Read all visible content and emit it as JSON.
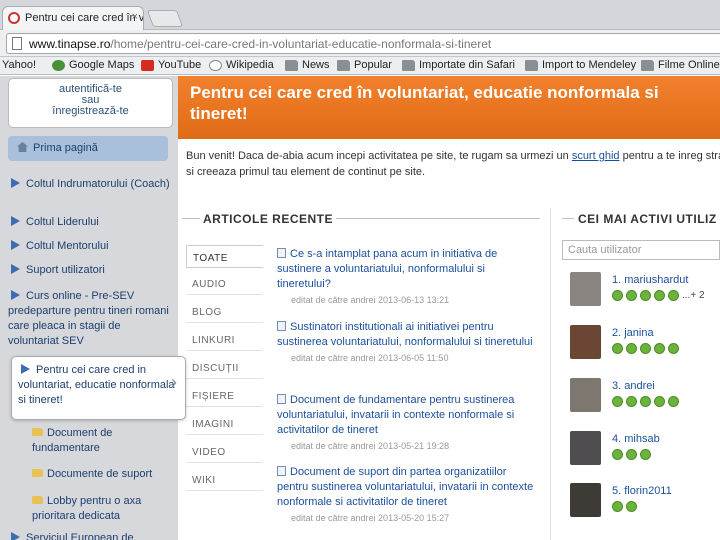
{
  "browser": {
    "tab_title": "Pentru cei care cred în volu",
    "close_glyph": "×",
    "url_host": "www.tinapse.ro",
    "url_path": "/home/pentru-cei-care-cred-in-voluntariat-educatie-nonformala-si-tineret",
    "bookmarks": [
      "Yahoo!",
      "Google Maps",
      "YouTube",
      "Wikipedia",
      "News",
      "Popular",
      "Importate din Safari",
      "Import to Mendeley",
      "Filme Online"
    ]
  },
  "sidebar": {
    "auth_line1": "autentifică-te",
    "auth_line2": "sau",
    "auth_line3": "înregistrează-te",
    "home": "Prima pagină",
    "items": [
      "Coltul Indrumatorului (Coach)",
      "Coltul Liderului",
      "Coltul Mentorului",
      "Suport utilizatori",
      "Curs online - Pre-SEV predeparture pentru tineri romani care pleaca in stagii de voluntariat SEV"
    ],
    "active_item": "Pentru cei care cred in voluntariat, educatie nonformala si tineret!",
    "chevron": "›",
    "subitems": [
      "Document de fundamentare",
      "Documente de suport",
      "Lobby pentru o axa prioritara dedicata"
    ],
    "bottom_item": "Serviciul European de"
  },
  "banner": {
    "title": "Pentru cei care cred în voluntariat, educatie nonformala si tineret!"
  },
  "intro": {
    "before_link": "Bun venit! Daca de-abia acum incepi activitatea pe site, te rugam sa urmezi un ",
    "link": "scurt ghid",
    "after_link": " pentru a te inreg stra, iar",
    "line2": "si creeaza primul tau element de continut pe site."
  },
  "articles": {
    "heading": "ARTICOLE RECENTE",
    "tabs": [
      "TOATE",
      "AUDIO",
      "BLOG",
      "LINKURI",
      "DISCUȚII",
      "FIȘIERE",
      "IMAGINI",
      "VIDEO",
      "WIKI"
    ],
    "items": [
      {
        "title": "Ce s-a intamplat pana acum in initiativa de sustinere a voluntariatului, nonformalului si tineretului?",
        "meta": "editat de către andrei 2013-06-13 13:21"
      },
      {
        "title": "Sustinatori institutionali ai initiativei pentru sustinerea voluntariatului, nonformalului si tineretului",
        "meta": "editat de către andrei 2013-06-05 11:50"
      },
      {
        "title": "Document de fundamentare pentru sustinerea voluntariatului, invatarii in contexte nonformale si activitatilor de tineret",
        "meta": "editat de către andrei 2013-05-21 19:28"
      },
      {
        "title": "Document de suport din partea organizatiilor pentru sustinerea voluntariatului, invatarii in contexte nonformale si activitatilor de tineret",
        "meta": "editat de către andrei 2013-05-20 15:27"
      }
    ]
  },
  "users": {
    "heading": "CEI MAI ACTIVI UTILIZ",
    "search_placeholder": "Cauta utilizator",
    "list": [
      {
        "name": "1. mariushardut",
        "badges": 5,
        "extra": "...+ 2",
        "avatar_color": "#8a8580"
      },
      {
        "name": "2. janina",
        "badges": 5,
        "extra": "",
        "avatar_color": "#6b4634"
      },
      {
        "name": "3. andrei",
        "badges": 5,
        "extra": "",
        "avatar_color": "#7e7770"
      },
      {
        "name": "4. mihsab",
        "badges": 3,
        "extra": "",
        "avatar_color": "#4f4d4f"
      },
      {
        "name": "5. florin2011",
        "badges": 2,
        "extra": "",
        "avatar_color": "#3e3a36"
      }
    ]
  }
}
